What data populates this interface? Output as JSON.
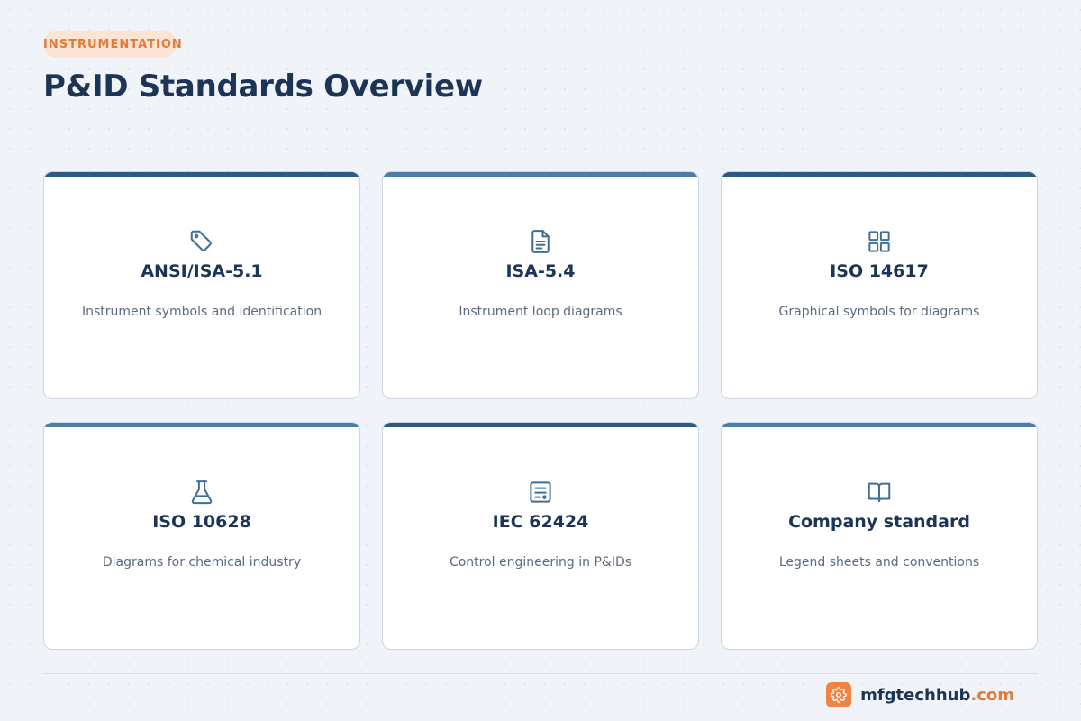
{
  "header": {
    "category": "INSTRUMENTATION",
    "title": "P&ID Standards Overview"
  },
  "colors": {
    "accent_orange": "#e07b3c",
    "badge_bg": "#fbe4d3",
    "title_navy": "#1c3557",
    "bar_dark": "#2d5986",
    "bar_light": "#4d7fa6"
  },
  "cards": [
    {
      "icon": "tag-icon",
      "title": "ANSI/ISA-5.1",
      "description": "Instrument symbols and identification",
      "bar_color": "#2d5986"
    },
    {
      "icon": "document-icon",
      "title": "ISA-5.4",
      "description": "Instrument loop diagrams",
      "bar_color": "#4d7fa6"
    },
    {
      "icon": "grid-icon",
      "title": "ISO 14617",
      "description": "Graphical symbols for diagrams",
      "bar_color": "#2d5986"
    },
    {
      "icon": "flask-icon",
      "title": "ISO 10628",
      "description": "Diagrams for chemical industry",
      "bar_color": "#4d7fa6"
    },
    {
      "icon": "form-icon",
      "title": "IEC 62424",
      "description": "Control engineering in P&IDs",
      "bar_color": "#2d5986"
    },
    {
      "icon": "book-icon",
      "title": "Company standard",
      "description": "Legend sheets and conventions",
      "bar_color": "#4d7fa6"
    }
  ],
  "footer": {
    "brand_name": "mfgtechhub",
    "brand_tld": ".com",
    "logo_icon": "gear-icon"
  }
}
